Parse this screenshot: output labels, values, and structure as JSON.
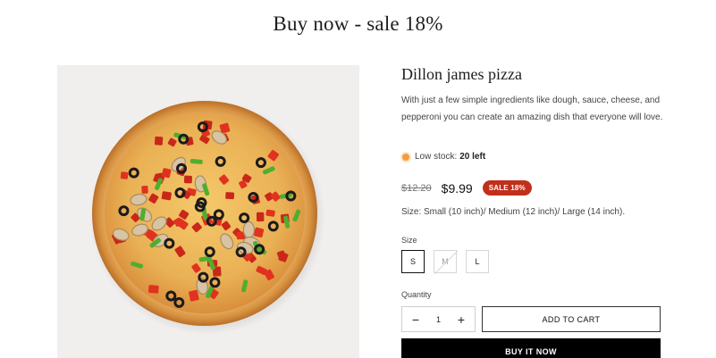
{
  "heading": "Buy now - sale 18%",
  "product": {
    "title": "Dillon james pizza",
    "description": "With just a few simple ingredients like dough, sauce, cheese, and pepperoni you can create an amazing dish that everyone will love.",
    "stock_label": "Low stock:",
    "stock_count": "20 left",
    "price_old": "$12.20",
    "price_new": "$9.99",
    "sale_badge": "SALE 18%",
    "sizes_note": "Size: Small (10 inch)/ Medium (12 inch)/ Large (14 inch).",
    "image_alt": "pizza-photo"
  },
  "size": {
    "label": "Size",
    "options": [
      {
        "label": "S",
        "state": "selected"
      },
      {
        "label": "M",
        "state": "disabled"
      },
      {
        "label": "L",
        "state": "available"
      }
    ]
  },
  "quantity": {
    "label": "Quantity",
    "value": "1",
    "minus": "−",
    "plus": "+"
  },
  "actions": {
    "add_to_cart": "ADD TO CART",
    "buy_now": "BUY IT NOW"
  },
  "colors": {
    "sale_badge": "#c0301c",
    "stock_dot": "#f39c42",
    "buy_now_bg": "#000000"
  }
}
